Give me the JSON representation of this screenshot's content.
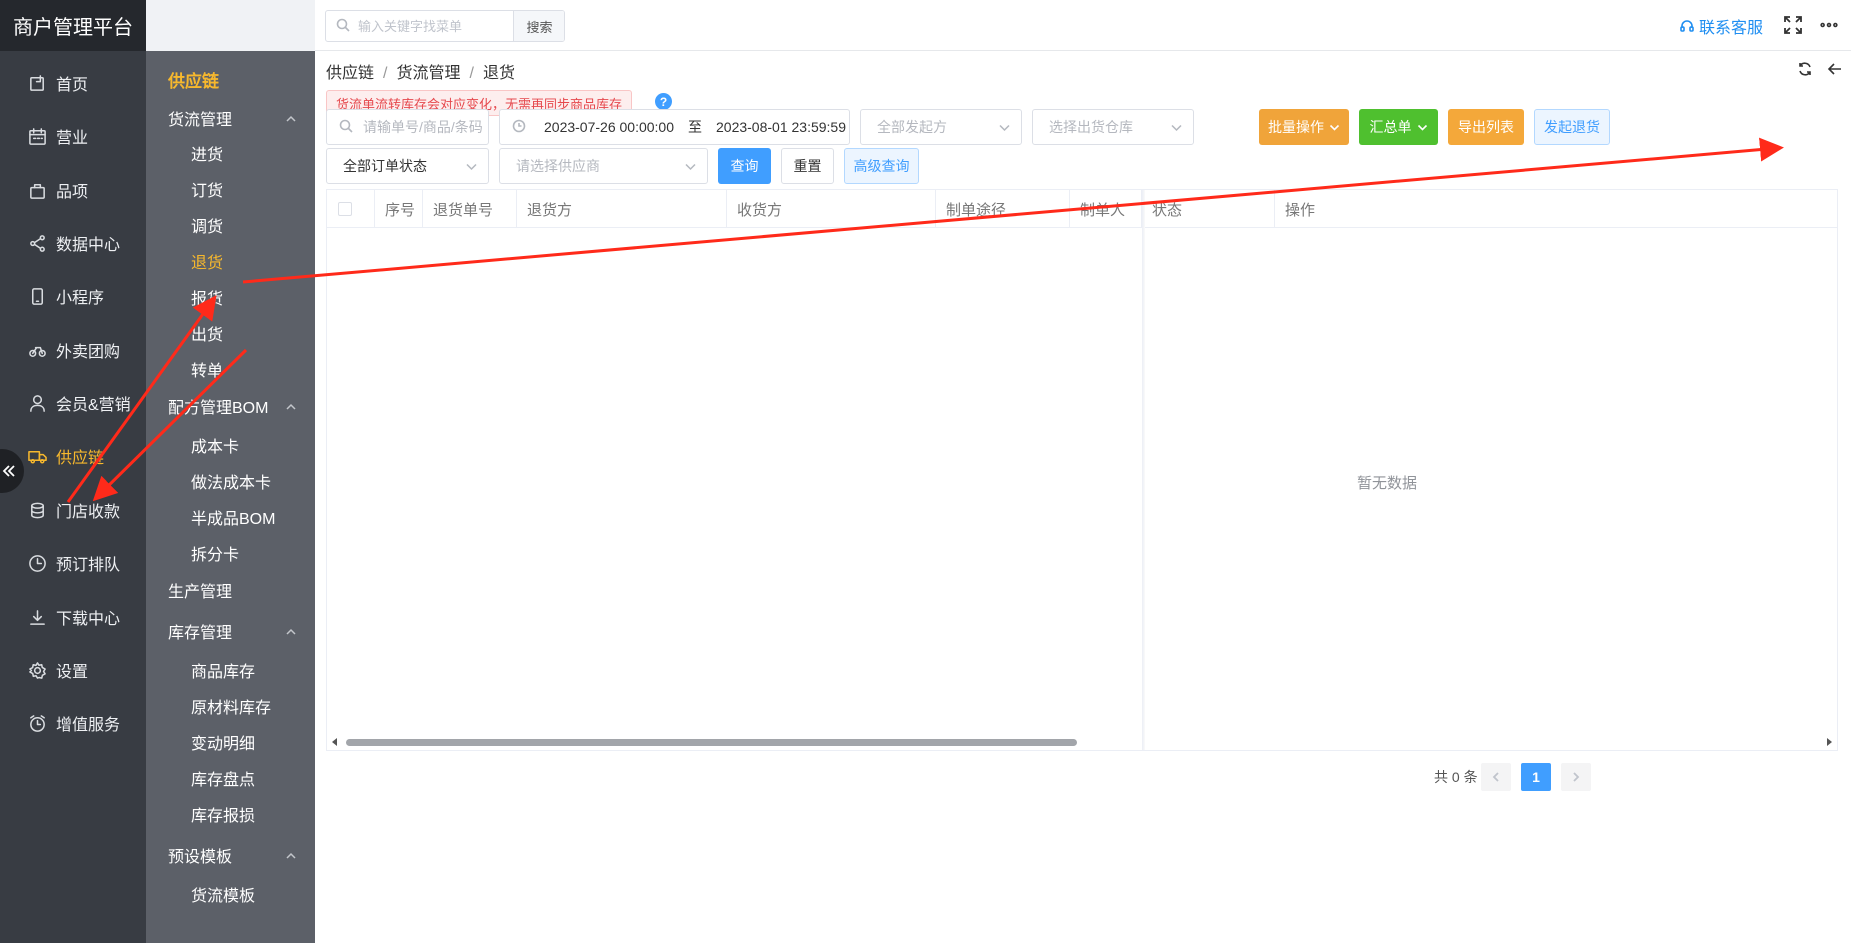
{
  "app": {
    "title": "商户管理平台"
  },
  "nav": {
    "items": [
      {
        "label": "首页",
        "icon": "home-icon"
      },
      {
        "label": "营业",
        "icon": "calendar-icon"
      },
      {
        "label": "品项",
        "icon": "bag-icon"
      },
      {
        "label": "数据中心",
        "icon": "share-icon"
      },
      {
        "label": "小程序",
        "icon": "phone-icon"
      },
      {
        "label": "外卖团购",
        "icon": "bike-icon"
      },
      {
        "label": "会员&营销",
        "icon": "user-icon"
      },
      {
        "label": "供应链",
        "icon": "truck-icon",
        "active": true
      },
      {
        "label": "门店收款",
        "icon": "coins-icon"
      },
      {
        "label": "预订排队",
        "icon": "clock-icon"
      },
      {
        "label": "下载中心",
        "icon": "download-icon"
      },
      {
        "label": "设置",
        "icon": "gear-icon"
      },
      {
        "label": "增值服务",
        "icon": "alarm-icon"
      }
    ]
  },
  "submenu": {
    "title": "供应链",
    "groups": {
      "goods_flow": "货流管理",
      "bom": "配方管理BOM",
      "production": "生产管理",
      "inventory": "库存管理",
      "preset": "预设模板"
    },
    "goods_flow_items": [
      "进货",
      "订货",
      "调货",
      "退货",
      "报货",
      "出货",
      "转单"
    ],
    "bom_items": [
      "成本卡",
      "做法成本卡",
      "半成品BOM",
      "拆分卡"
    ],
    "inventory_items": [
      "商品库存",
      "原材料库存",
      "变动明细",
      "库存盘点",
      "库存报损"
    ],
    "preset_items": [
      "货流模板"
    ],
    "active_item": "退货"
  },
  "topbar": {
    "search_placeholder": "输入关键字找菜单",
    "search_button": "搜索",
    "contact": "联系客服"
  },
  "breadcrumb": [
    "供应链",
    "货流管理",
    "退货"
  ],
  "notice": "货流单流转库存会对应变化，无需再同步商品库存",
  "help": "?",
  "filters": {
    "order_search_placeholder": "请输单号/商品/条码",
    "date_start": "2023-07-26 00:00:00",
    "date_sep": "至",
    "date_end": "2023-08-01 23:59:59",
    "initiator_placeholder": "全部发起方",
    "warehouse_placeholder": "选择出货仓库",
    "order_status": "全部订单状态",
    "supplier_placeholder": "请选择供应商"
  },
  "buttons": {
    "batch": "批量操作",
    "summary": "汇总单",
    "export": "导出列表",
    "initiate_return": "发起退货",
    "query": "查询",
    "reset": "重置",
    "advanced": "高级查询"
  },
  "table": {
    "columns": [
      "序号",
      "退货单号",
      "退货方",
      "收货方",
      "制单途径",
      "制单人",
      "状态",
      "操作"
    ],
    "rows": [],
    "empty_text": "暂无数据"
  },
  "pagination": {
    "total": "共 0 条",
    "current_page": "1"
  },
  "colors": {
    "accent": "#f7b82d",
    "primary": "#409eff",
    "annotation": "#ff2a1a"
  }
}
